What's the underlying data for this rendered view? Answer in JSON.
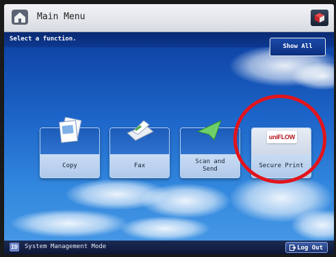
{
  "header": {
    "title": "Main Menu",
    "home_icon": "home-icon",
    "app_icon": "cube-icon"
  },
  "prompt": "Select a function.",
  "show_all_label": "Show All",
  "tiles": [
    {
      "label": "Copy",
      "icon": "copy-icon"
    },
    {
      "label": "Fax",
      "icon": "fax-icon"
    },
    {
      "label": "Scan and\nSend",
      "icon": "paper-plane-icon"
    },
    {
      "label": "Secure Print",
      "icon": "uniflow-logo",
      "logo_text": "uniFLOW"
    }
  ],
  "highlight": {
    "target": "Secure Print",
    "color": "#e3141b"
  },
  "footer": {
    "system_label": "System Management Mode",
    "id_badge": "ID",
    "logout_label": "Log Out"
  },
  "colors": {
    "sky_top": "#0b2f7e",
    "sky_bottom": "#4a9be6",
    "tile_label_bg": "#c9dcf3"
  }
}
